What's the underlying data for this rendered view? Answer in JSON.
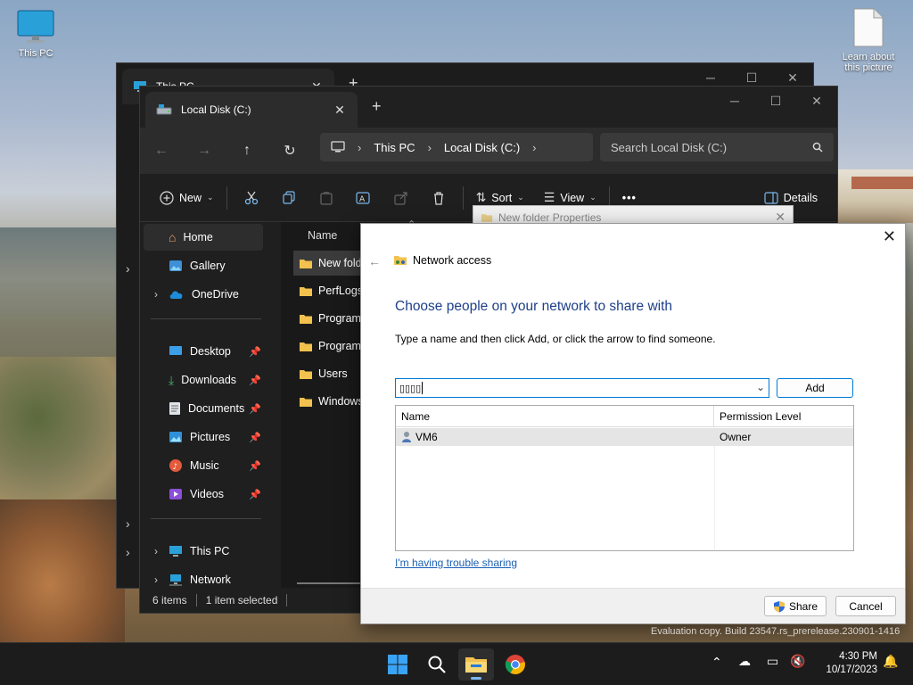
{
  "desktop": {
    "icons": [
      {
        "label": "This PC"
      },
      {
        "label": "Learn about this picture"
      }
    ],
    "watermark": "Evaluation copy. Build 23547.rs_prerelease.230901-1416"
  },
  "back_window": {
    "tab_title": "This PC"
  },
  "explorer": {
    "tab_title": "Local Disk (C:)",
    "new_tab": "+",
    "breadcrumb": [
      "This PC",
      "Local Disk (C:)"
    ],
    "search_placeholder": "Search Local Disk (C:)",
    "toolbar": {
      "new_label": "New",
      "sort_label": "Sort",
      "view_label": "View",
      "more_label": "•••",
      "details_label": "Details"
    },
    "sidebar": {
      "top": [
        {
          "label": "Home"
        },
        {
          "label": "Gallery"
        },
        {
          "label": "OneDrive"
        }
      ],
      "quick": [
        {
          "label": "Desktop"
        },
        {
          "label": "Downloads"
        },
        {
          "label": "Documents"
        },
        {
          "label": "Pictures"
        },
        {
          "label": "Music"
        },
        {
          "label": "Videos"
        }
      ],
      "bottom": [
        {
          "label": "This PC"
        },
        {
          "label": "Network"
        }
      ]
    },
    "column_name": "Name",
    "files": [
      {
        "name": "New folde"
      },
      {
        "name": "PerfLogs"
      },
      {
        "name": "Program"
      },
      {
        "name": "Program"
      },
      {
        "name": "Users"
      },
      {
        "name": "Windows"
      }
    ],
    "status": {
      "items": "6 items",
      "selected": "1 item selected"
    }
  },
  "properties": {
    "title": "New folder Properties"
  },
  "dialog": {
    "title": "Network access",
    "heading": "Choose people on your network to share with",
    "instructions": "Type a name and then click Add, or click the arrow to find someone.",
    "input_value": "▯▯▯▯",
    "add_label": "Add",
    "columns": [
      "Name",
      "Permission Level"
    ],
    "rows": [
      {
        "name": "VM6",
        "permission": "Owner"
      }
    ],
    "trouble_link": "I'm having trouble sharing",
    "share_label": "Share",
    "cancel_label": "Cancel"
  },
  "taskbar": {
    "time": "4:30 PM",
    "date": "10/17/2023"
  },
  "colors": {
    "accent": "#0078d4",
    "heading_blue": "#1e3f8a",
    "link_blue": "#1a5fb4",
    "dark_bg": "#1f1f1f"
  }
}
